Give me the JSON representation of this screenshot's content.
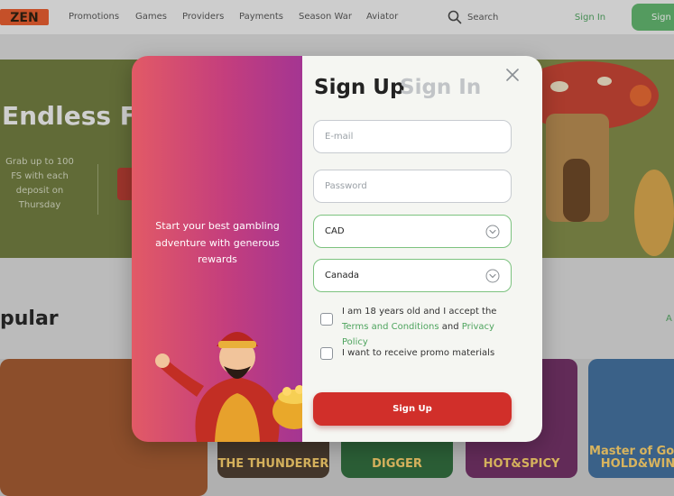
{
  "colors": {
    "accent_green": "#4ea45e",
    "signup_red": "#d12f2a",
    "promo_gradient_start": "#e25a66",
    "promo_gradient_end": "#a43592"
  },
  "header": {
    "logo_text": "ZEN",
    "nav": [
      "Promotions",
      "Games",
      "Providers",
      "Payments",
      "Season War",
      "Aviator"
    ],
    "search_label": "Search",
    "search_icon": "search-icon",
    "signin_label": "Sign In",
    "signup_label": "Sign"
  },
  "hero": {
    "title": "Endless FS",
    "text": "Grab up to 100 FS with each deposit on Thursday"
  },
  "popular": {
    "title": "pular",
    "link": "A"
  },
  "tiles": [
    "",
    "THE THUNDERER",
    "DIGGER",
    "HOT&SPICY",
    "Master of Gold HOLD&WIN"
  ],
  "modal": {
    "promo_text": "Start your best gambling adventure with generous rewards",
    "tabs": {
      "signup": "Sign Up",
      "signin": "Sign In"
    },
    "close_icon": "close-icon",
    "email_placeholder": "E-mail",
    "password_placeholder": "Password",
    "currency_value": "CAD",
    "country_value": "Canada",
    "dropdown_icon": "chevron-down-icon",
    "age_check": {
      "prefix": "I am 18 years old and I accept the ",
      "terms": "Terms and Conditions",
      "middle": " and ",
      "privacy": "Privacy Policy"
    },
    "promo_check": "I want to receive promo materials",
    "submit_label": "Sign Up"
  }
}
